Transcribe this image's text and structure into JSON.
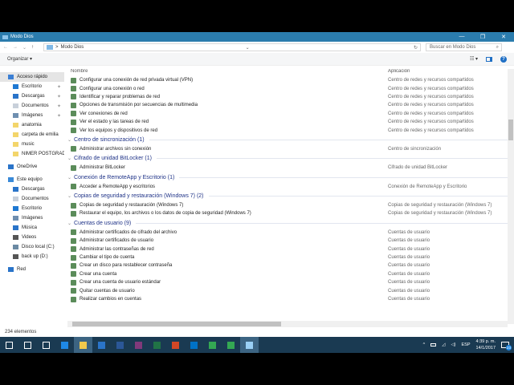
{
  "window": {
    "title": "Modo Dios",
    "minimize": "—",
    "maximize": "❐",
    "close": "✕"
  },
  "address": {
    "back": "←",
    "forward": "→",
    "recent": "⌄",
    "up": "↑",
    "path": "Modo Dios",
    "sep": ">",
    "dropdown": "⌄",
    "refresh": "↻",
    "search_placeholder": "Buscar en Modo Dios",
    "search_icon": "⌕"
  },
  "command": {
    "organize": "Organizar ▾",
    "view": "☷ ▾",
    "help": "?"
  },
  "nav": [
    {
      "label": "Acceso rápido",
      "top": true,
      "sel": true,
      "color": "#3b7fd4"
    },
    {
      "label": "Escritorio",
      "pin": true,
      "color": "#1e78d2"
    },
    {
      "label": "Descargas",
      "pin": true,
      "color": "#2a74c9"
    },
    {
      "label": "Documentos",
      "pin": true,
      "color": "#c8d0da"
    },
    {
      "label": "Imágenes",
      "pin": true,
      "color": "#6f8fb0"
    },
    {
      "label": "anatomia",
      "color": "#f3d56b"
    },
    {
      "label": "carpeta de emilia",
      "color": "#f3d56b"
    },
    {
      "label": "music",
      "color": "#f3d56b"
    },
    {
      "label": "NIMER POSTGRADO",
      "color": "#f3d56b"
    },
    {
      "label": "OneDrive",
      "top": true,
      "color": "#2a74c9",
      "gap": true
    },
    {
      "label": "Este equipo",
      "top": true,
      "color": "#3a8ad8",
      "gap": true
    },
    {
      "label": "Descargas",
      "color": "#2a74c9"
    },
    {
      "label": "Documentos",
      "color": "#c8d0da"
    },
    {
      "label": "Escritorio",
      "color": "#1e78d2"
    },
    {
      "label": "Imágenes",
      "color": "#6f8fb0"
    },
    {
      "label": "Música",
      "color": "#2a74c9"
    },
    {
      "label": "Videos",
      "color": "#555"
    },
    {
      "label": "Disco local (C:)",
      "color": "#6b8aa3"
    },
    {
      "label": "back up (D:)",
      "color": "#555"
    },
    {
      "label": "Red",
      "top": true,
      "color": "#2a74c9",
      "gap": true
    }
  ],
  "pin_icon": "✦",
  "columns": {
    "name": "Nombre",
    "app": "Aplicación",
    "sort": "^"
  },
  "items": [
    {
      "type": "row",
      "name": "Configurar una conexión de red privada virtual (VPN)",
      "app": "Centro de redes y recursos compartidos"
    },
    {
      "type": "row",
      "name": "Configurar una conexión o red",
      "app": "Centro de redes y recursos compartidos"
    },
    {
      "type": "row",
      "name": "Identificar y reparar problemas de red",
      "app": "Centro de redes y recursos compartidos"
    },
    {
      "type": "row",
      "name": "Opciones de transmisión por secuencias de multimedia",
      "app": "Centro de redes y recursos compartidos"
    },
    {
      "type": "row",
      "name": "Ver conexiones de red",
      "app": "Centro de redes y recursos compartidos"
    },
    {
      "type": "row",
      "name": "Ver el estado y las tareas de red",
      "app": "Centro de redes y recursos compartidos"
    },
    {
      "type": "row",
      "name": "Ver los equipos y dispositivos de red",
      "app": "Centro de redes y recursos compartidos"
    },
    {
      "type": "group",
      "name": "Centro de sincronización (1)"
    },
    {
      "type": "row",
      "name": "Administrar archivos sin conexión",
      "app": "Centro de sincronización"
    },
    {
      "type": "group",
      "name": "Cifrado de unidad BitLocker (1)"
    },
    {
      "type": "row",
      "name": "Administrar BitLocker",
      "app": "Cifrado de unidad BitLocker"
    },
    {
      "type": "group",
      "name": "Conexión de RemoteApp y Escritorio (1)"
    },
    {
      "type": "row",
      "name": "Acceder a RemoteApp y escritorios",
      "app": "Conexión de RemoteApp y Escritorio"
    },
    {
      "type": "group",
      "name": "Copias de seguridad y restauración (Windows 7) (2)"
    },
    {
      "type": "row",
      "name": "Copias de seguridad y restauración (Windows 7)",
      "app": "Copias de seguridad y restauración (Windows 7)"
    },
    {
      "type": "row",
      "name": "Restaurar el equipo, los archivos o los datos de copia de seguridad (Windows 7)",
      "app": "Copias de seguridad y restauración (Windows 7)"
    },
    {
      "type": "group",
      "name": "Cuentas de usuario (9)"
    },
    {
      "type": "row",
      "name": "Administrar certificados de cifrado del archivo",
      "app": "Cuentas de usuario"
    },
    {
      "type": "row",
      "name": "Administrar certificados de usuario",
      "app": "Cuentas de usuario"
    },
    {
      "type": "row",
      "name": "Administrar las contraseñas de red",
      "app": "Cuentas de usuario"
    },
    {
      "type": "row",
      "name": "Cambiar el tipo de cuenta",
      "app": "Cuentas de usuario"
    },
    {
      "type": "row",
      "name": "Crear un disco para restablecer contraseña",
      "app": "Cuentas de usuario"
    },
    {
      "type": "row",
      "name": "Crear una cuenta",
      "app": "Cuentas de usuario"
    },
    {
      "type": "row",
      "name": "Crear una cuenta de usuario estándar",
      "app": "Cuentas de usuario"
    },
    {
      "type": "row",
      "name": "Quitar cuentas de usuario",
      "app": "Cuentas de usuario"
    },
    {
      "type": "row",
      "name": "Realizar cambios en cuentas",
      "app": "Cuentas de usuario"
    }
  ],
  "group_chevron": "⌄",
  "status": {
    "count": "234 elementos"
  },
  "taskbar": {
    "apps": [
      "#fff",
      "#fff",
      "#fff",
      "#1e88e5",
      "#f2c94c",
      "#2a74c9",
      "#2b5797",
      "#80397b",
      "#217346",
      "#d24726",
      "#0072c6",
      "#34a853",
      "#34a853",
      "#9ad0f5"
    ],
    "tray_up": "^",
    "lang": "ESP",
    "time": "4:39 p. m.",
    "date": "14/1/2017",
    "notif": "23"
  }
}
